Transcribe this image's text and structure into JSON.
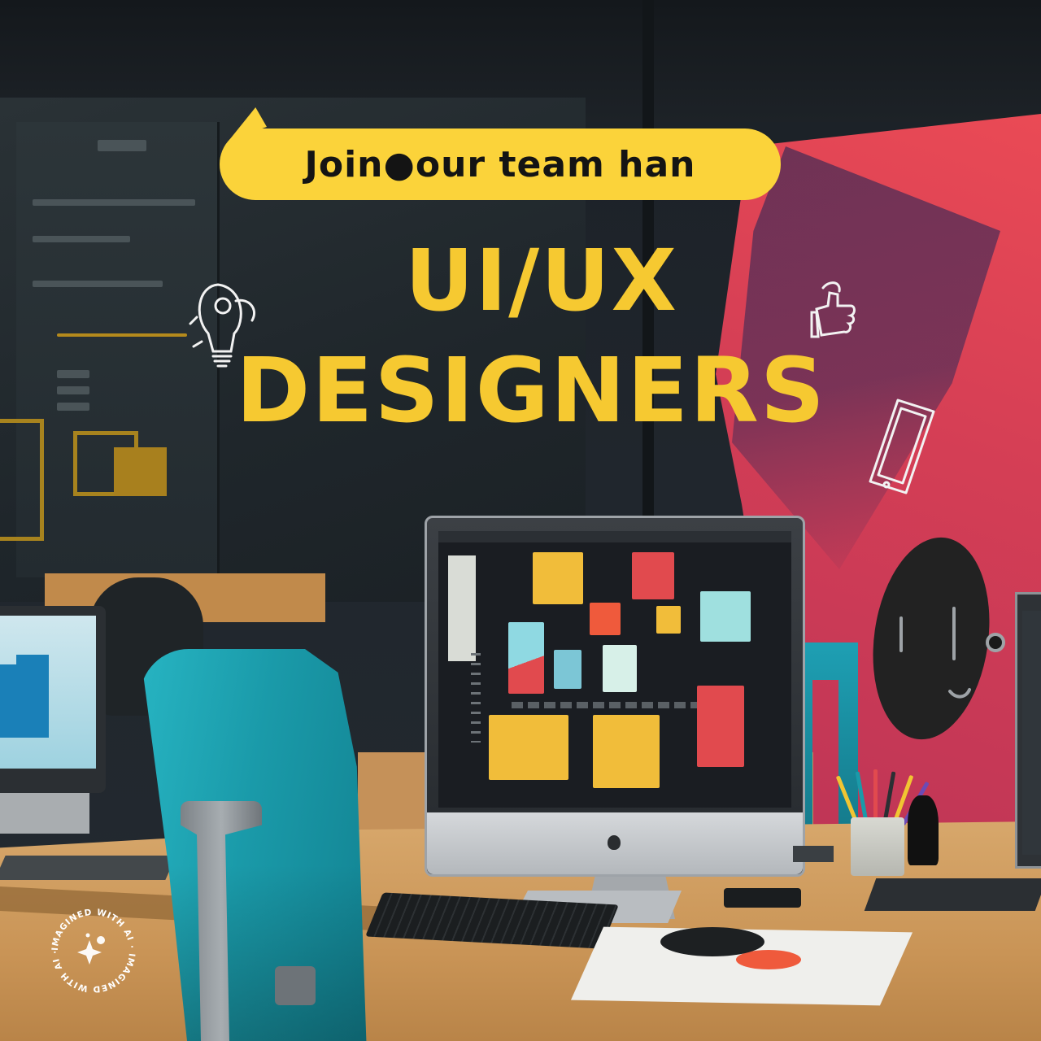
{
  "banner": {
    "text": "Join●our team han"
  },
  "headline": {
    "line1": "UI/UX",
    "line2": "DESIGNERS"
  },
  "watermark": {
    "text": "IMAGINED WITH AI · IMAGINED WITH AI · ",
    "icon": "sparkle-icon"
  },
  "colors": {
    "banner_yellow": "#fbd33a",
    "headline_yellow": "#f6c931",
    "wall_red": "#d43e55",
    "chair_teal": "#1a9aa9",
    "background_dark": "#1c2128"
  },
  "doodles": [
    "lightbulb-doodle-icon",
    "thumbs-up-doodle-icon",
    "smartphone-doodle-icon"
  ]
}
